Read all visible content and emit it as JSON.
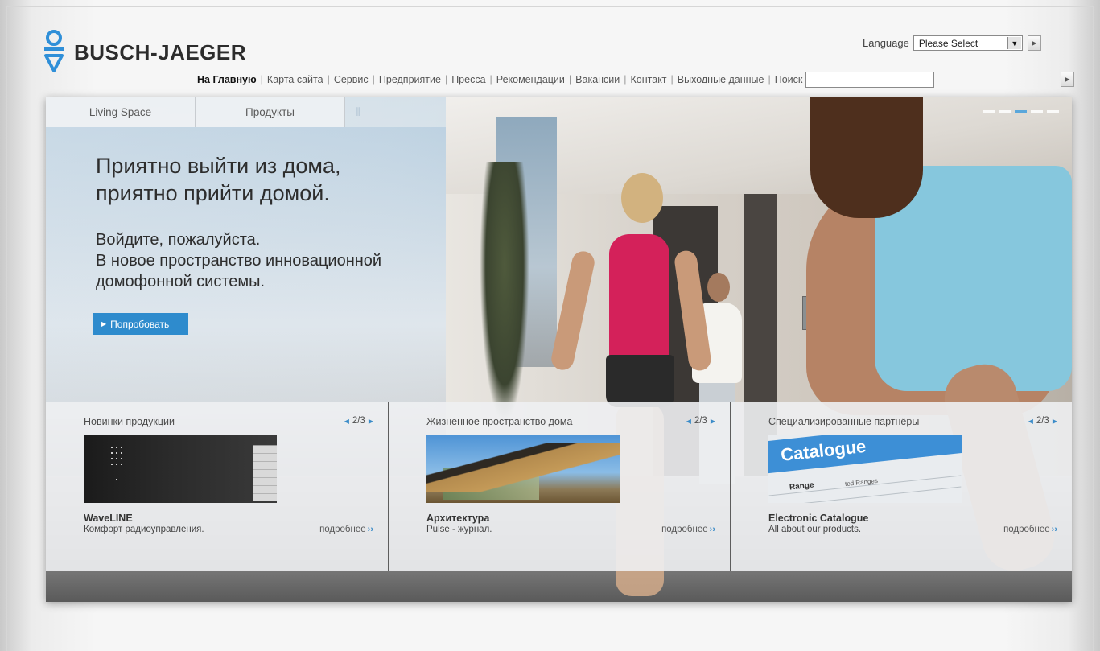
{
  "brand": {
    "name": "BUSCH-JAEGER"
  },
  "language": {
    "label": "Language",
    "selected": "Please Select"
  },
  "nav": {
    "items": [
      {
        "label": "На Главную",
        "active": true
      },
      {
        "label": "Карта сайта"
      },
      {
        "label": "Сервис"
      },
      {
        "label": "Предприятие"
      },
      {
        "label": "Пресса"
      },
      {
        "label": "Рекомендации"
      },
      {
        "label": "Вакансии"
      },
      {
        "label": "Контакт"
      },
      {
        "label": "Выходные данные"
      },
      {
        "label": "Поиск"
      }
    ],
    "search_value": ""
  },
  "hero": {
    "tabs": [
      "Living Space",
      "Продукты"
    ],
    "slides_total": 5,
    "active_slide": 3,
    "headline_line1": "Приятно выйти из дома,",
    "headline_line2": "приятно прийти домой.",
    "sub_line1": "Войдите, пожалуйста.",
    "sub_line2": "В новое пространство инновационной",
    "sub_line3": "домофонной системы.",
    "cta_label": "Попробовать"
  },
  "teasers": [
    {
      "title": "Новинки продукции",
      "pager": "2/3",
      "name": "WaveLINE",
      "desc": "Комфорт радиоуправления.",
      "more": "подробнее"
    },
    {
      "title": "Жизненное пространство дома",
      "pager": "2/3",
      "name": "Архитектура",
      "desc": "Pulse - журнал.",
      "more": "подробнее"
    },
    {
      "title": "Специализированные партнёры",
      "pager": "2/3",
      "name": "Electronic Catalogue",
      "desc": "All about our products.",
      "more": "подробнее"
    }
  ],
  "catalogue_image": {
    "headline": "Catalogue",
    "line1": "Range",
    "line2": "ted Ranges"
  },
  "colors": {
    "accent": "#2e8bcd",
    "active_dot": "#5aa7db",
    "logo_blue": "#2f8fd8"
  }
}
